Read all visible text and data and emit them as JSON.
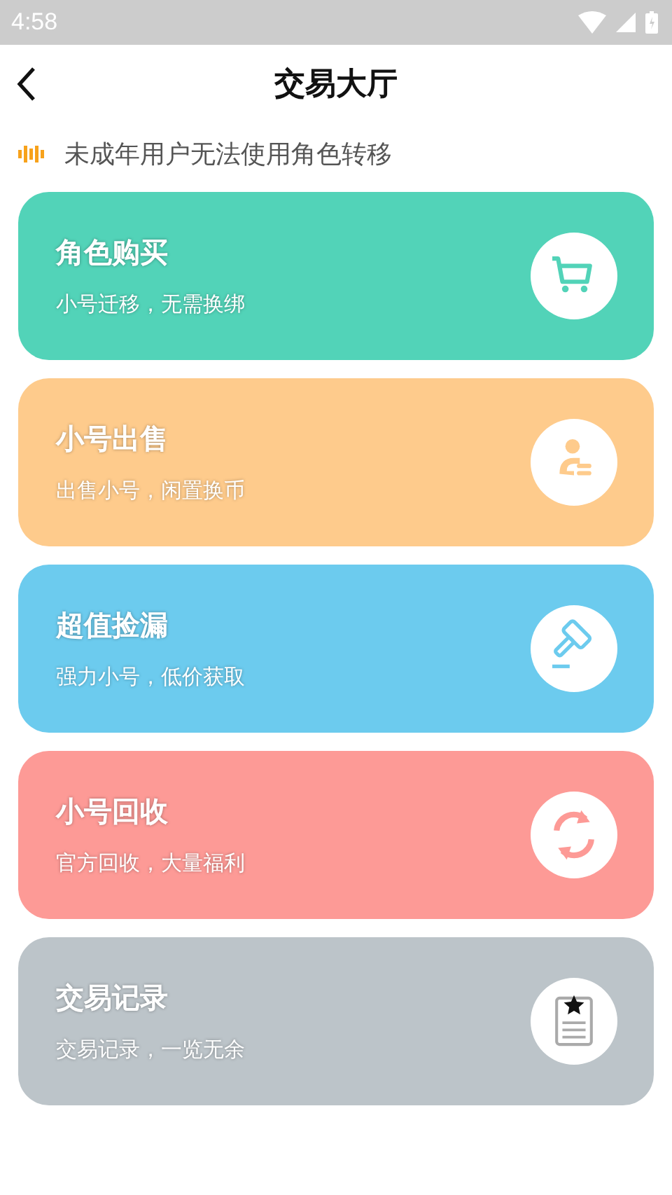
{
  "status_bar": {
    "time": "4:58"
  },
  "header": {
    "title": "交易大厅"
  },
  "notice": {
    "text": "未成年用户无法使用角色转移"
  },
  "cards": [
    {
      "title": "角色购买",
      "subtitle": "小号迁移，无需换绑",
      "color": "#52d3b8",
      "kind": "cart"
    },
    {
      "title": "小号出售",
      "subtitle": "出售小号，闲置换币",
      "color": "#fecb8c",
      "kind": "seller"
    },
    {
      "title": "超值捡漏",
      "subtitle": "强力小号，低价获取",
      "color": "#6ccbee",
      "kind": "hammer"
    },
    {
      "title": "小号回收",
      "subtitle": "官方回收，大量福利",
      "color": "#fd9a96",
      "kind": "recycle"
    },
    {
      "title": "交易记录",
      "subtitle": "交易记录，一览无余",
      "color": "#bcc4c9",
      "kind": "record"
    }
  ]
}
